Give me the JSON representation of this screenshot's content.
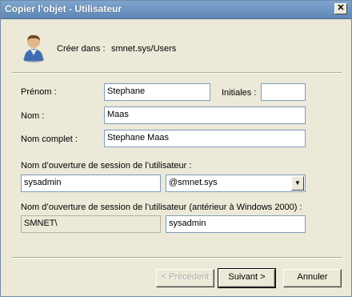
{
  "window": {
    "title": "Copier l’objet - Utilisateur",
    "close": "✕"
  },
  "header": {
    "create_in_label": "Créer dans :",
    "create_in_value": "smnet.sys/Users"
  },
  "form": {
    "first_name_label": "Prénom :",
    "first_name_value": "Stephane",
    "initials_label": "Initiales :",
    "initials_value": "",
    "last_name_label": "Nom :",
    "last_name_value": "Maas",
    "full_name_label": "Nom complet :",
    "full_name_value": "Stephane Maas",
    "logon_label": "Nom d’ouverture de session de l’utilisateur :",
    "logon_value": "sysadmin",
    "domain_value": "@smnet.sys",
    "legacy_label": "Nom d’ouverture de session de l’utilisateur (antérieur à Windows 2000) :",
    "legacy_prefix": "SMNET\\",
    "legacy_value": "sysadmin"
  },
  "buttons": {
    "previous": "< Précédent",
    "next": "Suivant >",
    "cancel": "Annuler"
  }
}
